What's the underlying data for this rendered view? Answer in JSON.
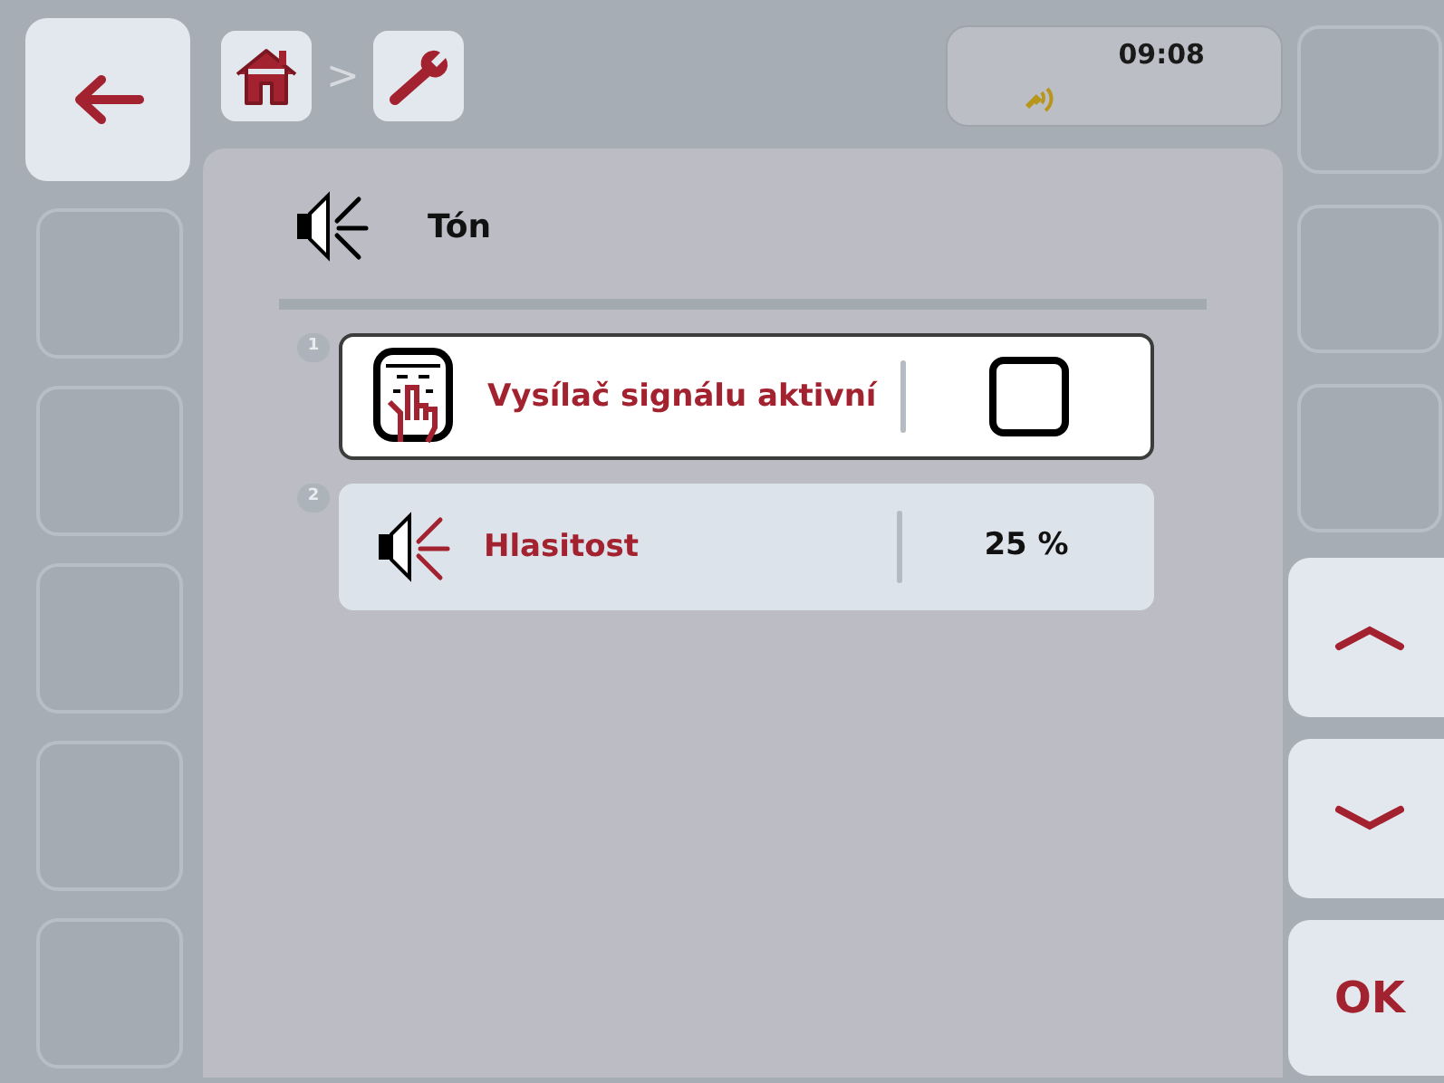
{
  "breadcrumb": {
    "separator": ">"
  },
  "status": {
    "time": "09:08"
  },
  "header": {
    "title": "Tón"
  },
  "items": [
    {
      "number": "1",
      "kind": "checkbox",
      "label": "Vysílač signálu aktivní",
      "selected": true,
      "checked": false
    },
    {
      "number": "2",
      "kind": "value",
      "label": "Hlasitost",
      "selected": false,
      "value": "25 %"
    }
  ],
  "ok_button": {
    "label": "OK"
  }
}
